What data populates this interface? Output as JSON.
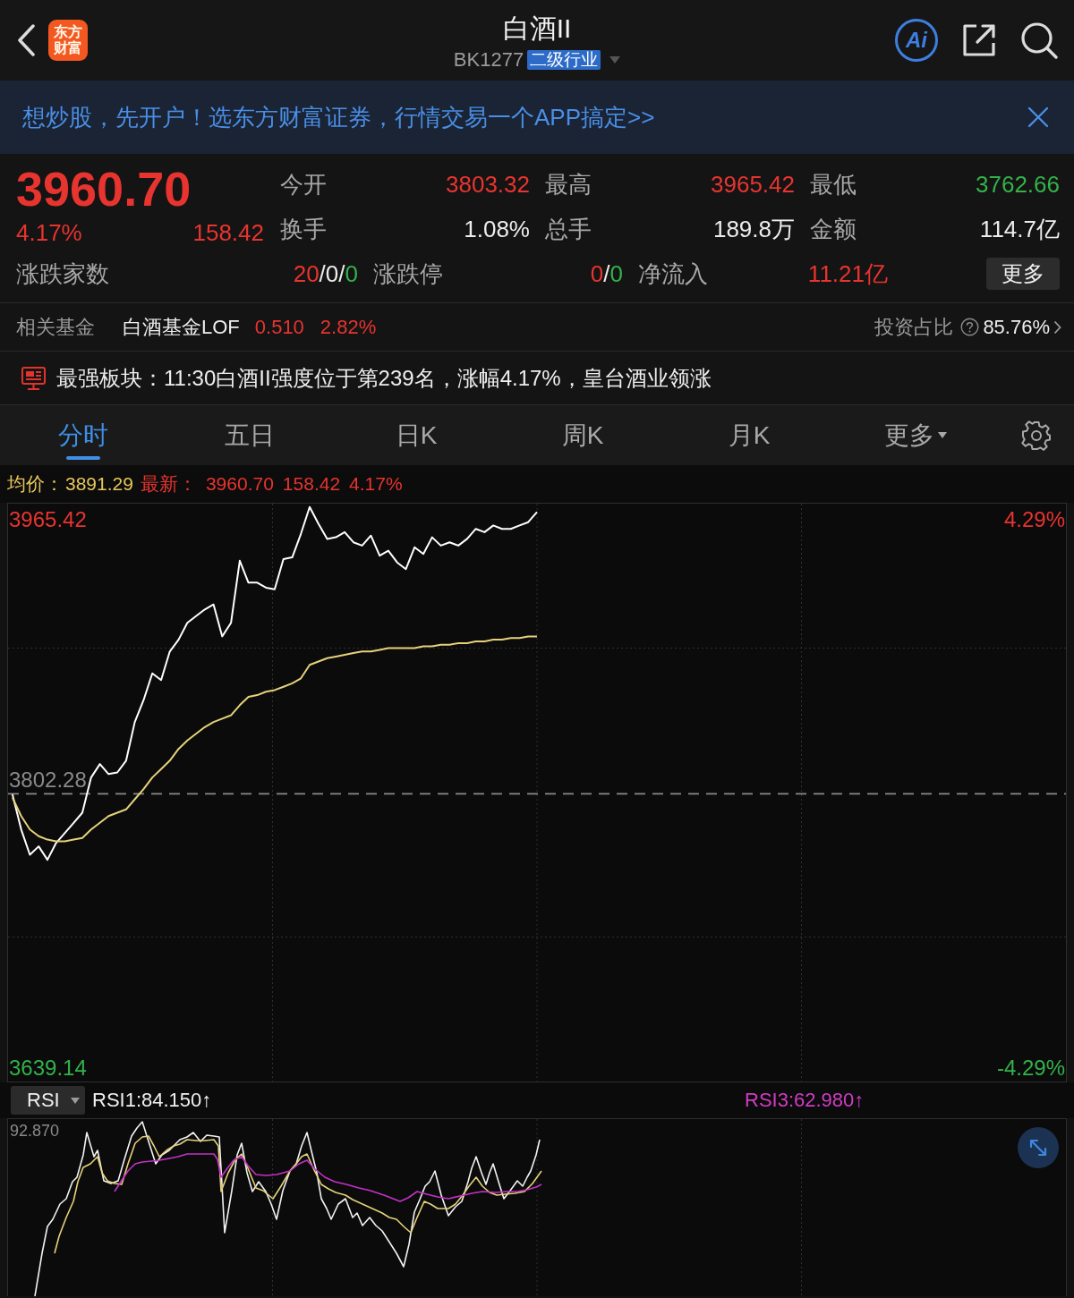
{
  "header": {
    "logo_text": "东方财富",
    "title": "白酒II",
    "code": "BK1277",
    "badge": "二级行业",
    "ai_label": "Ai"
  },
  "banner": {
    "text": "想炒股，先开户！选东方财富证券，行情交易一个APP搞定>>"
  },
  "quote": {
    "price": "3960.70",
    "change_pct": "4.17%",
    "change": "158.42",
    "color": "#e8342f"
  },
  "stats": [
    {
      "label": "今开",
      "value": "3803.32",
      "color": "#e8342f"
    },
    {
      "label": "最高",
      "value": "3965.42",
      "color": "#e8342f"
    },
    {
      "label": "最低",
      "value": "3762.66",
      "color": "#33b24a"
    },
    {
      "label": "换手",
      "value": "1.08%",
      "color": "#ededed"
    },
    {
      "label": "总手",
      "value": "189.8万",
      "color": "#ededed"
    },
    {
      "label": "金额",
      "value": "114.7亿",
      "color": "#ededed"
    }
  ],
  "breadth": [
    {
      "label": "涨跌家数",
      "segments": [
        {
          "text": "20",
          "color": "#e8342f"
        },
        {
          "text": "/0/",
          "color": "#ededed"
        },
        {
          "text": "0",
          "color": "#33b24a"
        }
      ]
    },
    {
      "label": "涨跌停",
      "segments": [
        {
          "text": "0",
          "color": "#e8342f"
        },
        {
          "text": "/",
          "color": "#ededed"
        },
        {
          "text": "0",
          "color": "#33b24a"
        }
      ]
    },
    {
      "label": "净流入",
      "segments": [
        {
          "text": "11.21亿",
          "color": "#e8342f"
        }
      ]
    }
  ],
  "more_button": "更多",
  "related_fund": {
    "label": "相关基金",
    "name": "白酒基金LOF",
    "price": "0.510",
    "change_pct": "2.82%",
    "color": "#e8342f",
    "ratio_label": "投资占比",
    "ratio": "85.76%"
  },
  "notice": {
    "text": "最强板块：11:30白酒II强度位于第239名，涨幅4.17%，皇台酒业领涨"
  },
  "tabs": [
    {
      "label": "分时",
      "selected": true,
      "kind": "tab"
    },
    {
      "label": "五日",
      "selected": false,
      "kind": "tab"
    },
    {
      "label": "日K",
      "selected": false,
      "kind": "tab"
    },
    {
      "label": "周K",
      "selected": false,
      "kind": "tab"
    },
    {
      "label": "月K",
      "selected": false,
      "kind": "tab"
    },
    {
      "label": "更多",
      "selected": false,
      "kind": "menu"
    }
  ],
  "chart_info": {
    "avg_label": "均价：",
    "avg_value": "3891.29",
    "latest_label": "最新：",
    "latest_values": [
      "3960.70",
      "158.42",
      "4.17%"
    ],
    "color": "#e8342f"
  },
  "chart": {
    "chart_data": {
      "type": "line",
      "ylim": [
        3631,
        3975
      ],
      "yticks": [
        {
          "value": 3965.42,
          "label": "3965.42"
        },
        {
          "value": 3639.14,
          "label": "3639.14"
        }
      ],
      "ref_lines": [
        {
          "axis": "y",
          "value": 3802.28,
          "label": "3802.28"
        }
      ],
      "series": [
        {
          "color": "#ffffff",
          "values": [
            3802,
            3781,
            3766,
            3771,
            3763,
            3773,
            3779,
            3785,
            3791,
            3812,
            3820,
            3814,
            3815,
            3822,
            3845,
            3858,
            3874,
            3870,
            3887,
            3894,
            3904,
            3908,
            3912,
            3915,
            3896,
            3904,
            3941,
            3928,
            3928,
            3925,
            3924,
            3942,
            3943,
            3957,
            3973,
            3963,
            3954,
            3955,
            3958,
            3952,
            3950,
            3956,
            3944,
            3947,
            3940,
            3936,
            3949,
            3945,
            3955,
            3950,
            3952,
            3950,
            3954,
            3960,
            3958,
            3962,
            3960,
            3960,
            3962,
            3964,
            3970,
            null,
            null,
            null,
            null,
            null,
            null,
            null,
            null,
            null,
            null,
            null,
            null,
            null,
            null,
            null,
            null,
            null,
            null,
            null,
            null,
            null,
            null,
            null,
            null,
            null,
            null,
            null,
            null,
            null,
            null,
            null,
            null,
            null,
            null,
            null,
            null,
            null,
            null,
            null,
            null,
            null,
            null,
            null,
            null,
            null,
            null,
            null,
            null,
            null,
            null,
            null,
            null,
            null,
            null,
            null,
            null,
            null,
            null,
            null,
            null
          ]
        },
        {
          "color": "#e6d27a",
          "values": [
            3800,
            3789,
            3781,
            3777,
            3775,
            3774,
            3774,
            3775,
            3776,
            3781,
            3785,
            3789,
            3791,
            3793,
            3799,
            3805,
            3812,
            3817,
            3822,
            3829,
            3834,
            3838,
            3842,
            3845,
            3847,
            3849,
            3855,
            3860,
            3861,
            3863,
            3864,
            3866,
            3868,
            3871,
            3879,
            3881,
            3883,
            3884,
            3885,
            3886,
            3887,
            3887,
            3888,
            3889,
            3889,
            3889,
            3889,
            3890,
            3890,
            3891,
            3891,
            3892,
            3892,
            3893,
            3893,
            3894,
            3894,
            3895,
            3895,
            3896,
            3896,
            null,
            null,
            null,
            null,
            null,
            null,
            null,
            null,
            null,
            null,
            null,
            null,
            null,
            null,
            null,
            null,
            null,
            null,
            null,
            null,
            null,
            null,
            null,
            null,
            null,
            null,
            null,
            null,
            null,
            null,
            null,
            null,
            null,
            null,
            null,
            null,
            null,
            null,
            null,
            null,
            null,
            null,
            null,
            null,
            null,
            null,
            null,
            null,
            null,
            null,
            null,
            null,
            null,
            null,
            null,
            null,
            null,
            null,
            null,
            null
          ]
        }
      ]
    },
    "pct_labels": [
      {
        "text": "4.29%",
        "color": "#e8342f"
      },
      {
        "text": "-4.29%",
        "color": "#33b24a"
      }
    ]
  },
  "rsi": {
    "selector": "RSI",
    "readings": [
      {
        "text": "RSI1:84.150↑",
        "kind": "rsi1"
      },
      {
        "text": "RSI3:62.980↑",
        "kind": "rsi3"
      }
    ],
    "top_label": "92.870"
  }
}
